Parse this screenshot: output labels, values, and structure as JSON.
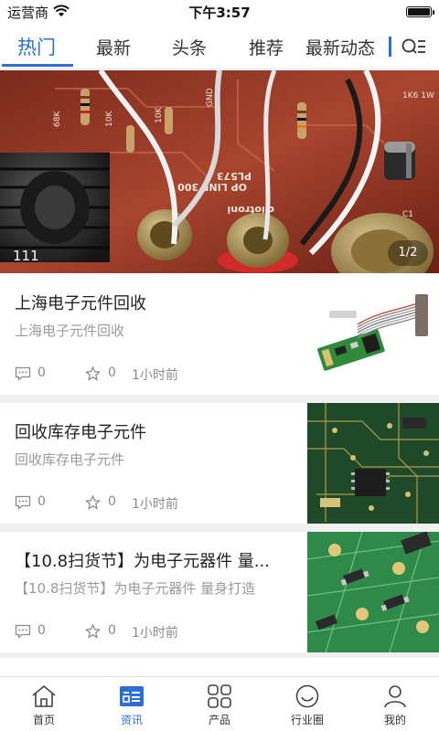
{
  "status_bar": {
    "carrier": "运营商",
    "time": "下午3:57",
    "wifi_icon": "wifi-icon",
    "battery_icon": "battery-icon"
  },
  "tabs": {
    "active_color": "#2a6fd6",
    "items": [
      {
        "label": "热门",
        "active": true
      },
      {
        "label": "最新",
        "active": false
      },
      {
        "label": "头条",
        "active": false
      },
      {
        "label": "推荐",
        "active": false
      },
      {
        "label": "最新动态",
        "active": false
      }
    ],
    "menu_icon": "search-menu-icon"
  },
  "banner": {
    "caption": "111",
    "indicator": "1/2"
  },
  "articles": [
    {
      "title": "上海电子元件回收",
      "summary": "上海电子元件回收",
      "comments": "0",
      "favorites": "0",
      "time": "1小时前"
    },
    {
      "title": "回收库存电子元件",
      "summary": "回收库存电子元件",
      "comments": "0",
      "favorites": "0",
      "time": "1小时前"
    },
    {
      "title": "【10.8扫货节】为电子元器件 量...",
      "summary": "【10.8扫货节】为电子元器件 量身打造",
      "comments": "0",
      "favorites": "0",
      "time": "1小时前"
    }
  ],
  "bottom_nav": {
    "items": [
      {
        "label": "首页",
        "icon": "home-icon",
        "active": false
      },
      {
        "label": "资讯",
        "icon": "news-icon",
        "active": true
      },
      {
        "label": "产品",
        "icon": "grid-icon",
        "active": false
      },
      {
        "label": "行业圈",
        "icon": "smile-icon",
        "active": false
      },
      {
        "label": "我的",
        "icon": "user-icon",
        "active": false
      }
    ]
  }
}
